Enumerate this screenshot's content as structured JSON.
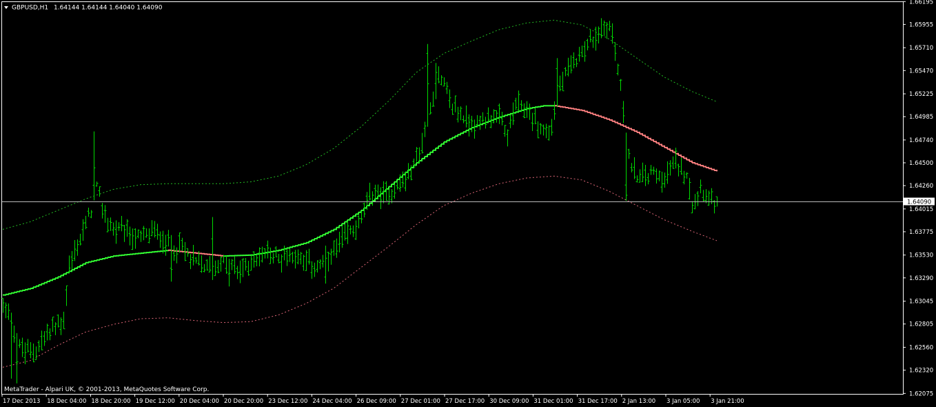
{
  "header": {
    "symbol": "GBPUSD,H1",
    "quote": "1.64144 1.64144 1.64040 1.64090"
  },
  "footer": {
    "copyright": "MetaTrader - Alpari UK, © 2001-2013, MetaQuotes Software Corp."
  },
  "colors": {
    "background": "#000000",
    "frame": "#ffffff",
    "bars": "#00dd00",
    "midline_up": "#33ff33",
    "midline_down": "#ff8080",
    "band_upper": "#22bb22",
    "band_lower": "#dd6677",
    "price_line": "#bbbbbb"
  },
  "chart_data": {
    "type": "ohlc",
    "symbol": "GBPUSD",
    "timeframe": "H1",
    "ylim": [
      1.6207,
      1.6619
    ],
    "y_ticks": [
      "1.66195",
      "1.65955",
      "1.65710",
      "1.65470",
      "1.65225",
      "1.64985",
      "1.64740",
      "1.64500",
      "1.64260",
      "1.64015",
      "1.63775",
      "1.63530",
      "1.63290",
      "1.63045",
      "1.62805",
      "1.62560",
      "1.62320",
      "1.62075"
    ],
    "x_ticks": [
      "17 Dec 2013",
      "18 Dec 04:00",
      "18 Dec 20:00",
      "19 Dec 12:00",
      "20 Dec 04:00",
      "20 Dec 20:00",
      "23 Dec 12:00",
      "24 Dec 04:00",
      "26 Dec 09:00",
      "27 Dec 01:00",
      "27 Dec 17:00",
      "30 Dec 09:00",
      "31 Dec 01:00",
      "31 Dec 17:00",
      "2 Jan 13:00",
      "3 Jan 05:00",
      "3 Jan 21:00"
    ],
    "current_price": "1.64090",
    "last_bar": {
      "open": 1.64144,
      "high": 1.64144,
      "low": 1.6404,
      "close": 1.6409
    },
    "bar_count": 260,
    "price_path": [
      [
        0,
        1.63
      ],
      [
        3,
        1.629
      ],
      [
        5,
        1.626
      ],
      [
        8,
        1.625
      ],
      [
        12,
        1.6255
      ],
      [
        18,
        1.6275
      ],
      [
        22,
        1.6285
      ],
      [
        24,
        1.634
      ],
      [
        28,
        1.637
      ],
      [
        32,
        1.64
      ],
      [
        34,
        1.643
      ],
      [
        36,
        1.64
      ],
      [
        40,
        1.638
      ],
      [
        45,
        1.6375
      ],
      [
        50,
        1.637
      ],
      [
        55,
        1.6378
      ],
      [
        60,
        1.6365
      ],
      [
        65,
        1.636
      ],
      [
        70,
        1.6345
      ],
      [
        75,
        1.634
      ],
      [
        80,
        1.6345
      ],
      [
        85,
        1.6335
      ],
      [
        90,
        1.6345
      ],
      [
        95,
        1.6355
      ],
      [
        100,
        1.635
      ],
      [
        105,
        1.6355
      ],
      [
        110,
        1.6345
      ],
      [
        115,
        1.634
      ],
      [
        120,
        1.6355
      ],
      [
        125,
        1.6375
      ],
      [
        130,
        1.639
      ],
      [
        134,
        1.642
      ],
      [
        138,
        1.6415
      ],
      [
        143,
        1.6425
      ],
      [
        148,
        1.644
      ],
      [
        152,
        1.647
      ],
      [
        155,
        1.651
      ],
      [
        158,
        1.654
      ],
      [
        160,
        1.653
      ],
      [
        163,
        1.651
      ],
      [
        168,
        1.6495
      ],
      [
        172,
        1.649
      ],
      [
        176,
        1.65
      ],
      [
        180,
        1.6495
      ],
      [
        183,
        1.648
      ],
      [
        186,
        1.651
      ],
      [
        190,
        1.6505
      ],
      [
        194,
        1.649
      ],
      [
        198,
        1.648
      ],
      [
        202,
        1.653
      ],
      [
        206,
        1.655
      ],
      [
        210,
        1.657
      ],
      [
        214,
        1.658
      ],
      [
        218,
        1.659
      ],
      [
        220,
        1.6595
      ],
      [
        222,
        1.657
      ],
      [
        224,
        1.653
      ],
      [
        226,
        1.648
      ],
      [
        228,
        1.644
      ],
      [
        232,
        1.6435
      ],
      [
        236,
        1.644
      ],
      [
        240,
        1.6435
      ],
      [
        244,
        1.645
      ],
      [
        248,
        1.644
      ],
      [
        250,
        1.641
      ],
      [
        253,
        1.6425
      ],
      [
        256,
        1.6415
      ],
      [
        259,
        1.6409
      ]
    ],
    "wick_spikes": [
      {
        "bar": 3,
        "low": 1.6223
      },
      {
        "bar": 5,
        "low": 1.6218
      },
      {
        "bar": 33,
        "high": 1.6483
      },
      {
        "bar": 34,
        "high": 1.6425
      },
      {
        "bar": 61,
        "low": 1.6325
      },
      {
        "bar": 76,
        "high": 1.6393
      },
      {
        "bar": 82,
        "low": 1.632
      },
      {
        "bar": 117,
        "low": 1.6323
      },
      {
        "bar": 154,
        "high": 1.6575
      },
      {
        "bar": 157,
        "high": 1.6555
      },
      {
        "bar": 201,
        "high": 1.656
      },
      {
        "bar": 217,
        "high": 1.6602
      },
      {
        "bar": 219,
        "high": 1.6598
      },
      {
        "bar": 226,
        "low": 1.641
      }
    ],
    "envelope": {
      "mid": [
        [
          0,
          1.6311
        ],
        [
          10,
          1.6318
        ],
        [
          20,
          1.633
        ],
        [
          30,
          1.6345
        ],
        [
          40,
          1.6352
        ],
        [
          50,
          1.6355
        ],
        [
          60,
          1.6358
        ],
        [
          70,
          1.6355
        ],
        [
          80,
          1.6352
        ],
        [
          90,
          1.6353
        ],
        [
          100,
          1.6358
        ],
        [
          110,
          1.6366
        ],
        [
          120,
          1.638
        ],
        [
          130,
          1.64
        ],
        [
          140,
          1.6425
        ],
        [
          150,
          1.645
        ],
        [
          160,
          1.6472
        ],
        [
          170,
          1.6487
        ],
        [
          180,
          1.6498
        ],
        [
          190,
          1.6507
        ],
        [
          196,
          1.651
        ],
        [
          200,
          1.651
        ],
        [
          210,
          1.6505
        ],
        [
          220,
          1.6495
        ],
        [
          230,
          1.6482
        ],
        [
          240,
          1.6466
        ],
        [
          250,
          1.645
        ],
        [
          260,
          1.644
        ]
      ],
      "upper": [
        [
          0,
          1.638
        ],
        [
          10,
          1.6388
        ],
        [
          20,
          1.64
        ],
        [
          30,
          1.6412
        ],
        [
          40,
          1.6422
        ],
        [
          50,
          1.6427
        ],
        [
          60,
          1.6428
        ],
        [
          70,
          1.6428
        ],
        [
          80,
          1.6428
        ],
        [
          90,
          1.643
        ],
        [
          100,
          1.6436
        ],
        [
          110,
          1.6448
        ],
        [
          120,
          1.6465
        ],
        [
          130,
          1.6488
        ],
        [
          140,
          1.6515
        ],
        [
          150,
          1.6545
        ],
        [
          160,
          1.6565
        ],
        [
          170,
          1.6578
        ],
        [
          180,
          1.659
        ],
        [
          190,
          1.6597
        ],
        [
          200,
          1.66
        ],
        [
          210,
          1.6595
        ],
        [
          220,
          1.658
        ],
        [
          230,
          1.656
        ],
        [
          240,
          1.654
        ],
        [
          250,
          1.6525
        ],
        [
          260,
          1.6513
        ]
      ],
      "lower": [
        [
          0,
          1.6235
        ],
        [
          10,
          1.6242
        ],
        [
          20,
          1.6258
        ],
        [
          30,
          1.6272
        ],
        [
          40,
          1.628
        ],
        [
          50,
          1.6286
        ],
        [
          60,
          1.6287
        ],
        [
          70,
          1.6284
        ],
        [
          80,
          1.6282
        ],
        [
          90,
          1.6283
        ],
        [
          100,
          1.629
        ],
        [
          110,
          1.6302
        ],
        [
          120,
          1.6318
        ],
        [
          130,
          1.634
        ],
        [
          140,
          1.6362
        ],
        [
          150,
          1.6385
        ],
        [
          160,
          1.6405
        ],
        [
          170,
          1.6418
        ],
        [
          180,
          1.6428
        ],
        [
          190,
          1.6434
        ],
        [
          200,
          1.6436
        ],
        [
          210,
          1.6432
        ],
        [
          220,
          1.642
        ],
        [
          230,
          1.6405
        ],
        [
          240,
          1.639
        ],
        [
          250,
          1.6378
        ],
        [
          260,
          1.6367
        ]
      ]
    }
  }
}
